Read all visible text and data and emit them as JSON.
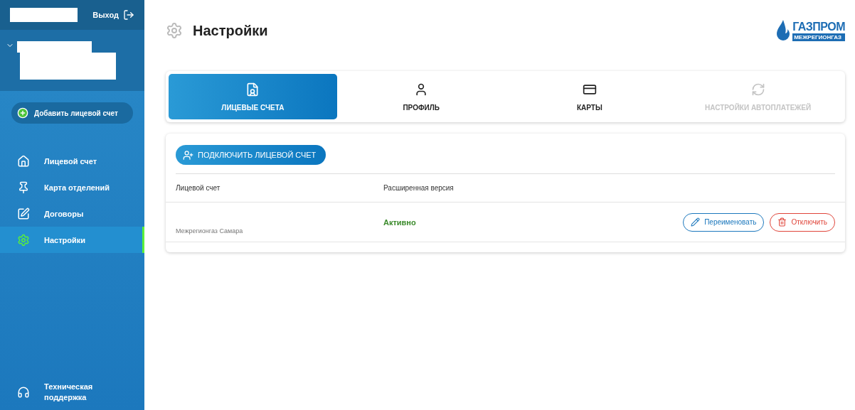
{
  "sidebar": {
    "logout": "Выход",
    "add_account": "Добавить лицевой счет",
    "items": [
      {
        "label": "Лицевой счет",
        "selected": false
      },
      {
        "label": "Карта отделений",
        "selected": false
      },
      {
        "label": "Договоры",
        "selected": false
      },
      {
        "label": "Настройки",
        "selected": true
      }
    ],
    "support": "Техническая поддержка"
  },
  "page": {
    "title": "Настройки",
    "logo": {
      "name": "ГАЗПРОМ",
      "sub": "МЕЖРЕГИОНГАЗ"
    }
  },
  "tabs": [
    {
      "label": "ЛИЦЕВЫЕ СЧЕТА",
      "selected": true,
      "disabled": false
    },
    {
      "label": "ПРОФИЛЬ",
      "selected": false,
      "disabled": false
    },
    {
      "label": "КАРТЫ",
      "selected": false,
      "disabled": false
    },
    {
      "label": "НАСТРОЙКИ АВТОПЛАТЕЖЕЙ",
      "selected": false,
      "disabled": true
    }
  ],
  "connect_button": "ПОДКЛЮЧИТЬ ЛИЦЕВОЙ СЧЕТ",
  "table": {
    "columns": [
      "Лицевой счет",
      "Расширенная версия"
    ],
    "rows": [
      {
        "account": "Межрегионгаз Самара",
        "status": "Активно",
        "active": true,
        "rename": "Переименовать",
        "disconnect": "Отключить"
      }
    ]
  }
}
